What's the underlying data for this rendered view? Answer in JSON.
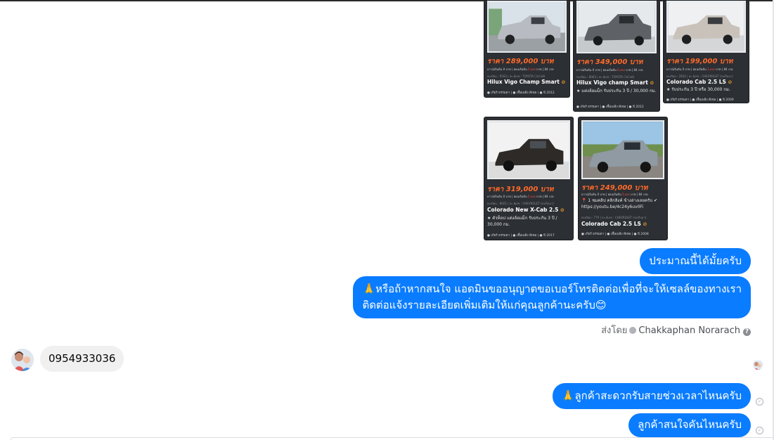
{
  "cards": [
    {
      "price": "ราคา 289,000 บาท",
      "terms_a": "ดาวน์เริ่มต้น 0 บาท | ผ่อนเริ่มต้น ",
      "terms_red": "5,xxx",
      "terms_b": " บาท | 84 งวด",
      "meta": "ทะเบียน : 9503 | สะ.ย์เลข : TOYOTA (โฮโลท์)",
      "model": "Hilux Vigo Champ Smart",
      "features": "",
      "footer": "● เกียร์ ธรรมดา   |   ● เชื้อเพลิง ดีเซล   |   ● ปี 2012",
      "photo_color": "#b8bcc2"
    },
    {
      "price": "ราคา 349,000 บาท",
      "terms_a": "ดาวน์เริ่มต้น 0 บาท | ผ่อนเริ่มต้น ",
      "terms_red": "6,xxx",
      "terms_b": " บาท | 84 งวด",
      "meta": "ทะเบียน : 8063 | สะ.ย์เลข : TOYOTA (โฮโลท์)",
      "model": "Hilux Vigo champ Smart",
      "features": "★ แต่งล้อแม็ก รับประกัน 3 ปี / 30,000 กม.",
      "footer": "● เกียร์ ธรรมดา   |   ● เชื้อเพลิง ดีเซล   |   ● ปี 2012",
      "photo_color": "#6f7378"
    },
    {
      "price": "ราคา 199,000 บาท",
      "terms_a": "ดาวน์เริ่มต้น 0 บาท | ผ่อนเริ่มต้น ",
      "terms_red": "3,xxx",
      "terms_b": " บาท | 84 งวด",
      "meta": "ทะเบียน : 2832 | สะ.ย์เลข : CHEVROLET (รถเก็บมา)",
      "model": "Colorado Cab 2.5 LS",
      "features": "★ รับประกัน 3 ปี หรือ 30,000 กม.",
      "footer": "● เกียร์ ธรรมดา   |   ● เชื้อเพลิง ดีเซล   |   ● ปี 2009",
      "photo_color": "#c9c2bb"
    },
    {
      "price": "ราคา 319,000 บาท",
      "terms_a": "ดาวน์เริ่มต้น 0 บาท | ผ่อนเริ่มต้น ",
      "terms_red": "5,xxx",
      "terms_b": " บาท | 84 งวด",
      "meta": "ทะเบียน : 8021 | สะ.ย์เลข : CHEVROLET (รถเก็บมา)",
      "model": "Colorado New X-Cab 2.5",
      "features": "★ ตัวท็อป แต่งล้อแม็ก รับประกัน 3 ปี / 30,000 กม.",
      "footer": "● เกียร์ ธรรมดา   |   ● เชื้อเพลิง ดีเซล   |   ● ปี 2017",
      "photo_color": "#2e2a27"
    },
    {
      "price": "ราคา 249,000 บาท",
      "terms_a": "ดาวน์เริ่มต้น 0 บาท | ผ่อนเริ่มต้น ",
      "terms_red": "5,xxx",
      "terms_b": " บาท | 84 งวด",
      "meta": "ทะเบียน : 770 | สะ.ย์เลข : CHEVROLET (รถเก็บมา)",
      "model": "Colorado Cab 2.5 LS",
      "features": "📍 1 ชมคลิป คลิกลิงค์ ข้างล่างเลยครับ ✔ https://youtu.be/4c24y6uv0Fi",
      "footer": "● เกียร์ ธรรมดา   |   ● เชื้อเพลิง ดีเซล   |   ● ปี 2008",
      "photo_color": "#8f9aa3"
    }
  ],
  "messages": {
    "msg1": "ประมาณนี้ได้มั้ยครับ",
    "msg2_line1": "🙏หรือถ้าหากสนใจ แอดมินขออนุญาตขอเบอร์โทรติดต่อเพื่อที่จะให้เซลล์ของทางเรา",
    "msg2_line2": "ติดต่อแจ้งรายละเอียดเพิ่มเติมให้แก่คุณลูกค้านะครับ😊",
    "sent_by_prefix": "ส่งโดย",
    "sender_name": "Chakkaphan Norarach",
    "help_glyph": "?",
    "incoming_phone": "0954933036",
    "msg3": "🙏ลูกค้าสะดวกรับสายช่วงเวลาไหนครับ",
    "msg4": "ลูกค้าสนใจคันไหนครับ"
  },
  "colors": {
    "outgoing_bubble": "#0a7cff",
    "incoming_bubble": "#f0f0f0",
    "card_background": "#2c2f33",
    "price_orange": "#ff6a2b"
  }
}
